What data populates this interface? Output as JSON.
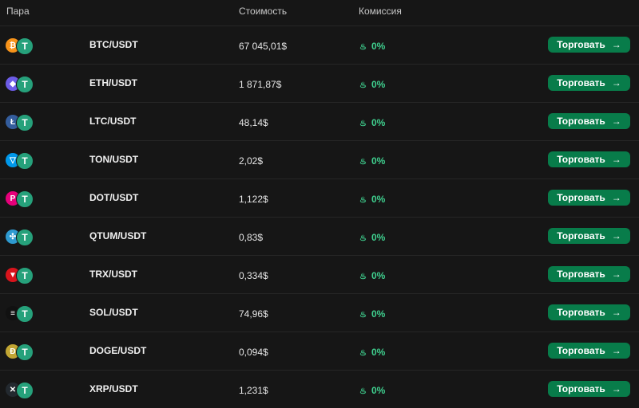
{
  "header": {
    "pair": "Пара",
    "price": "Стоимость",
    "fee": "Комиссия"
  },
  "rows": [
    {
      "pair": "BTC/USDT",
      "price": "67 045,01$",
      "fee": "0%",
      "button": "Торговать",
      "coin_icon": "bitcoin-icon",
      "coin_color": "#f7931a",
      "coin_glyph": "₿"
    },
    {
      "pair": "ETH/USDT",
      "price": "1 871,87$",
      "fee": "0%",
      "button": "Торговать",
      "coin_icon": "ethereum-icon",
      "coin_color": "#6c5ce7",
      "coin_glyph": "◆"
    },
    {
      "pair": "LTC/USDT",
      "price": "48,14$",
      "fee": "0%",
      "button": "Торговать",
      "coin_icon": "litecoin-icon",
      "coin_color": "#345d9d",
      "coin_glyph": "Ł"
    },
    {
      "pair": "TON/USDT",
      "price": "2,02$",
      "fee": "0%",
      "button": "Торговать",
      "coin_icon": "toncoin-icon",
      "coin_color": "#0098ea",
      "coin_glyph": "▽"
    },
    {
      "pair": "DOT/USDT",
      "price": "1,122$",
      "fee": "0%",
      "button": "Торговать",
      "coin_icon": "polkadot-icon",
      "coin_color": "#e6007a",
      "coin_glyph": "P"
    },
    {
      "pair": "QTUM/USDT",
      "price": "0,83$",
      "fee": "0%",
      "button": "Торговать",
      "coin_icon": "qtum-icon",
      "coin_color": "#2e9ad0",
      "coin_glyph": "✣"
    },
    {
      "pair": "TRX/USDT",
      "price": "0,334$",
      "fee": "0%",
      "button": "Торговать",
      "coin_icon": "tron-icon",
      "coin_color": "#d8141c",
      "coin_glyph": "▼"
    },
    {
      "pair": "SOL/USDT",
      "price": "74,96$",
      "fee": "0%",
      "button": "Торговать",
      "coin_icon": "solana-icon",
      "coin_color": "#111111",
      "coin_glyph": "≡"
    },
    {
      "pair": "DOGE/USDT",
      "price": "0,094$",
      "fee": "0%",
      "button": "Торговать",
      "coin_icon": "dogecoin-icon",
      "coin_color": "#c2a633",
      "coin_glyph": "Ð"
    },
    {
      "pair": "XRP/USDT",
      "price": "1,231$",
      "fee": "0%",
      "button": "Торговать",
      "coin_icon": "xrp-icon",
      "coin_color": "#23292f",
      "coin_glyph": "✕"
    }
  ],
  "tether_glyph": "T",
  "flame_glyph": "♨",
  "arrow_glyph": "→",
  "colors": {
    "background": "#161616",
    "accent_green": "#3fcf8e",
    "button_bg": "#087c4a",
    "tether": "#26a17b"
  }
}
